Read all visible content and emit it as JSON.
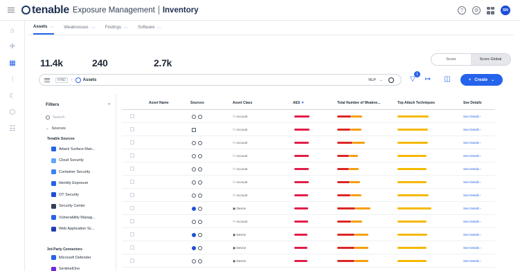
{
  "app": {
    "brand": "tenable",
    "product": "Exposure Management",
    "page": "Inventory",
    "user_initials": "SN"
  },
  "tabs": [
    {
      "label": "Assets",
      "count": "",
      "active": true
    },
    {
      "label": "Weaknesses",
      "count": ""
    },
    {
      "label": "Findings",
      "count": ""
    },
    {
      "label": "Software",
      "count": ""
    }
  ],
  "stats": [
    {
      "label": "",
      "value": "11.4k"
    },
    {
      "label": "",
      "value": "240"
    },
    {
      "label": "",
      "value": "2.7k"
    }
  ],
  "score_toggle": {
    "left": "Score",
    "right": "Score Global"
  },
  "search": {
    "find_label": "FIND",
    "scope": "Assets",
    "placeholder": "",
    "nlp_label": "NLP",
    "filter_count": "1"
  },
  "create_button": "Create",
  "filters": {
    "title": "Filters",
    "search_placeholder": "Search",
    "sources_label": "Sources",
    "tenable_group": "Tenable Sources",
    "tenable_items": [
      {
        "label": "Attack Surface Man...",
        "count": "",
        "color": "#2563eb"
      },
      {
        "label": "Cloud Security",
        "count": "",
        "color": "#60a5fa"
      },
      {
        "label": "Container Security",
        "count": "",
        "color": "#3b82f6"
      },
      {
        "label": "Identity Exposure",
        "count": "",
        "color": "#2563eb"
      },
      {
        "label": "OT Security",
        "count": "",
        "color": "#1d4ed8"
      },
      {
        "label": "Security Center",
        "count": "",
        "color": "#334155"
      },
      {
        "label": "Vulnerability Manag...",
        "count": "",
        "color": "#2563eb"
      },
      {
        "label": "Web Application Sc...",
        "count": "",
        "color": "#1e40af"
      }
    ],
    "third_party_group": "3rd Party Connectors",
    "third_party_items": [
      {
        "label": "Microsoft Defender",
        "count": "",
        "color": "#2563eb"
      },
      {
        "label": "SentinelOne",
        "count": "",
        "color": "#6d28d9"
      }
    ]
  },
  "table": {
    "columns": [
      "Asset Name",
      "Sources",
      "Asset Class",
      "AES",
      "Total Number of Weakne...",
      "Top Attack Techniques",
      "See Details"
    ],
    "sort_indicator": "▼",
    "link_label": "See Details",
    "rows": [
      {
        "name": "",
        "class": "Account",
        "aes": "",
        "aes_frac": 0.92,
        "weak": "",
        "weak_frac": 0.72,
        "top": "",
        "top_frac": 0.9
      },
      {
        "name": "",
        "class": "Account",
        "aes": "",
        "aes_frac": 0.9,
        "weak": "",
        "weak_frac": 0.7,
        "top": "",
        "top_frac": 0.88
      },
      {
        "name": "",
        "class": "Account",
        "aes": "",
        "aes_frac": 0.88,
        "weak": "",
        "weak_frac": 0.8,
        "top": "",
        "top_frac": 0.87
      },
      {
        "name": "",
        "class": "Account",
        "aes": "",
        "aes_frac": 0.87,
        "weak": "",
        "weak_frac": 0.6,
        "top": "",
        "top_frac": 0.84
      },
      {
        "name": "",
        "class": "Account",
        "aes": "",
        "aes_frac": 0.86,
        "weak": "",
        "weak_frac": 0.62,
        "top": "",
        "top_frac": 0.84
      },
      {
        "name": "",
        "class": "Account",
        "aes": "",
        "aes_frac": 0.86,
        "weak": "",
        "weak_frac": 0.65,
        "top": "",
        "top_frac": 0.84
      },
      {
        "name": "",
        "class": "Account",
        "aes": "",
        "aes_frac": 0.84,
        "weak": "",
        "weak_frac": 0.7,
        "top": "",
        "top_frac": 0.9
      },
      {
        "name": "",
        "class": "Device",
        "aes": "",
        "aes_frac": 0.82,
        "weak": "",
        "weak_frac": 0.95,
        "top": "",
        "top_frac": 0.98
      },
      {
        "name": "",
        "class": "Account",
        "aes": "",
        "aes_frac": 0.82,
        "weak": "",
        "weak_frac": 0.72,
        "top": "",
        "top_frac": 0.84
      },
      {
        "name": "",
        "class": "Device",
        "aes": "",
        "aes_frac": 0.8,
        "weak": "",
        "weak_frac": 0.9,
        "top": "",
        "top_frac": 0.86
      },
      {
        "name": "",
        "class": "Device",
        "aes": "",
        "aes_frac": 0.8,
        "weak": "",
        "weak_frac": 0.9,
        "top": "",
        "top_frac": 0.84
      },
      {
        "name": "",
        "class": "Device",
        "aes": "",
        "aes_frac": 0.8,
        "weak": "",
        "weak_frac": 0.9,
        "top": "",
        "top_frac": 0.84
      }
    ]
  },
  "colors": {
    "accent": "#2563eb",
    "aes_bar": "#e11d48",
    "weak_red": "#dc2626",
    "weak_orange": "#f59e0b",
    "top_bar": "#f5b800"
  }
}
